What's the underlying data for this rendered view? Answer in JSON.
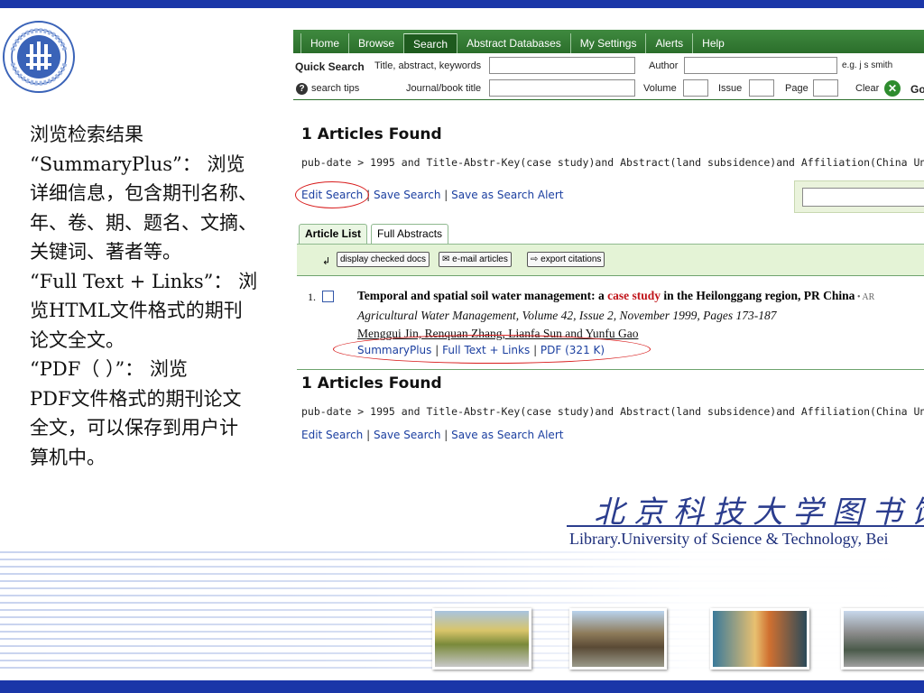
{
  "description": {
    "lines": [
      "浏览检索结果",
      "“SummaryPlus”： 浏览",
      "详细信息，包含期刊名称、",
      "年、卷、期、题名、文摘、",
      "关键词、著者等。",
      "“Full Text + Links”： 浏",
      "览HTML文件格式的期刊",
      "论文全文。",
      "“PDF（ ）”： 浏览",
      "PDF文件格式的期刊论文",
      "全文，可以保存到用户计",
      "算机中。"
    ]
  },
  "nav": {
    "tabs": [
      "Home",
      "Browse",
      "Search",
      "Abstract Databases",
      "My Settings",
      "Alerts",
      "Help"
    ],
    "active": "Search"
  },
  "quick_search": {
    "title": "Quick Search",
    "field1_label": "Title, abstract, keywords",
    "author_label": "Author",
    "author_hint": "e.g. j s smith",
    "help_link": "search tips",
    "journal_label": "Journal/book title",
    "volume_label": "Volume",
    "issue_label": "Issue",
    "page_label": "Page",
    "clear_label": "Clear",
    "go_label": "Go"
  },
  "results": {
    "found_top": "1 Articles Found",
    "query_top": "pub-date > 1995 and Title-Abstr-Key(case study)and Abstract(land subsidence)and Affiliation(China Universit",
    "edit_search": "Edit Search",
    "save_search": "Save Search",
    "save_alert": "Save as Search Alert",
    "tab_article_list": "Article List",
    "tab_full_abstracts": "Full Abstracts",
    "btn_display_checked": "display checked docs",
    "btn_email": "e-mail articles",
    "btn_export": "export citations",
    "found_bottom": "1 Articles Found",
    "query_bottom": "pub-date > 1995 and Title-Abstr-Key(case study)and Abstract(land subsidence)and Affiliation(China Universit"
  },
  "article": {
    "number": "1.",
    "title_before": "Temporal and spatial soil water management: a ",
    "title_highlight": "case study",
    "title_after": " in the Heilonggang region, PR China",
    "title_extra": " • AR",
    "journal": "Agricultural Water Management, Volume 42, Issue 2, November 1999, Pages 173-187",
    "authors": "Menggui Jin, Renquan Zhang, Lianfa Sun and Yunfu Gao",
    "link_summary": "SummaryPlus",
    "link_fulltext": "Full Text + Links",
    "link_pdf": "PDF (321 K)"
  },
  "library": {
    "name_cn": "北京科技大学图书馆",
    "name_en": "Library.University of Science & Technology, Bei"
  },
  "colors": {
    "frame_blue": "#1a36a8",
    "nav_green": "#2b6e2b",
    "link_blue": "#1b3fa0",
    "highlight_red": "#c0141a",
    "oval_red": "#d81c1c"
  }
}
